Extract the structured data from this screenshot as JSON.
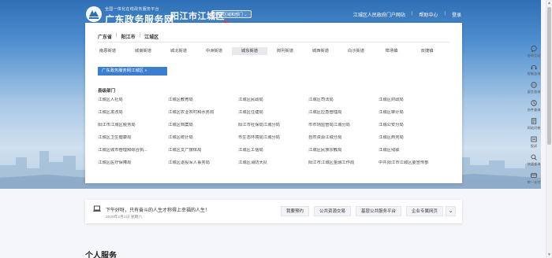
{
  "header": {
    "logo_slogan": "全国一体化在线政务服务平台",
    "logo_title": "广东政务服务网",
    "region_title": "阳江市江城区",
    "switch_label": "切换区域和部门",
    "links": [
      "江城区人民政府门户网站",
      "帮助中心",
      "登录"
    ]
  },
  "panel": {
    "breadcrumb": [
      "广东省",
      "阳江市",
      "江城区"
    ],
    "streets": [
      "南恩街道",
      "城南街道",
      "城北街道",
      "中洲街道",
      "城东街道",
      "岗列街道",
      "城西街道",
      "白沙街道",
      "埠场镇",
      "双捷镇"
    ],
    "active_street": "城东街道",
    "portal_button": "广东政务服务网江城区 »",
    "dept_title": "县级部门",
    "departments": [
      "江城区人社局",
      "江城区教育局",
      "江城区民政局",
      "江城区司法局",
      "江城区财政局",
      "江城区发改局",
      "江城区农业农村和水务局",
      "江城区住建局",
      "江城区应急管理局",
      "江城区审计局",
      "阳江市江城区税务局",
      "江城区档案局",
      "阳江市社保局江城分局",
      "市市场监管局江城分局",
      "江城公安分局",
      "江城区卫生健康局",
      "江城区统计局",
      "市生态环境局江城分局",
      "自然资源江城分局",
      "江城区商务局",
      "江城区城市管理和综合执...",
      "江城区文广旅体局",
      "江城区工信局",
      "江城区民族宗教局",
      "江城区残联",
      "江城区医疗保障局",
      "江城区退役军人事务局",
      "江城区消防大队",
      "阳江市江城区金融工作局",
      "中共阳江市江城区委宣传部"
    ]
  },
  "notice": {
    "text": "下午好呀，只有奋斗的人生才称得上幸福的人生！",
    "date": "2020年2月1日 星期六",
    "buttons": [
      "我要预约",
      "公共资源交易",
      "基层公共服务平台",
      "企业专属网页"
    ]
  },
  "section_title": "个人服务",
  "sidebar": [
    {
      "label": "咨询互动",
      "icon": "chat-icon"
    },
    {
      "label": "智能咨询",
      "icon": "robot-icon"
    },
    {
      "label": "留言咨询",
      "icon": "message-icon"
    },
    {
      "label": "办件查询",
      "icon": "clock-icon"
    },
    {
      "label": "网站问卷",
      "icon": "document-icon"
    },
    {
      "label": "投诉",
      "icon": "complaint-icon"
    },
    {
      "label": "快速查询",
      "icon": "search-icon"
    },
    {
      "label": "统一支付",
      "icon": "payment-icon"
    }
  ],
  "colors": {
    "primary": "#3b7ed0",
    "banner_top": "#2f6fb5",
    "arrow": "#e23b3b"
  }
}
